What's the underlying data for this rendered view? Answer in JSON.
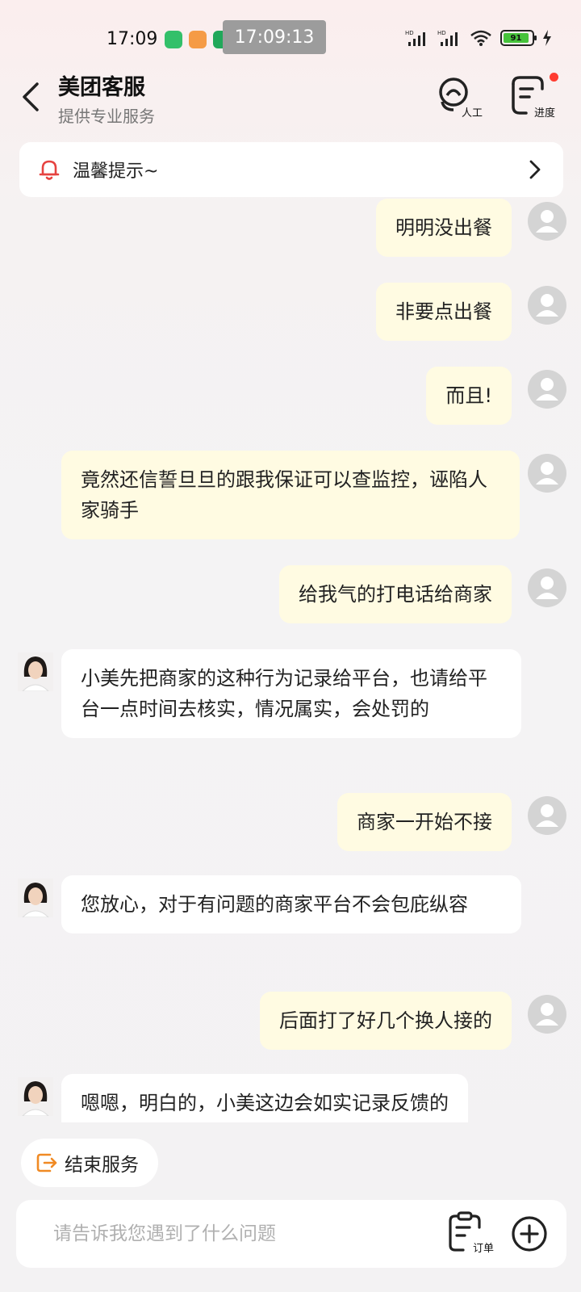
{
  "status_bar": {
    "time": "17:09",
    "overlay_time": "17:09:13",
    "battery": "91",
    "app_icons": [
      "green-app-icon",
      "meituan-app-icon",
      "green-app-icon-2"
    ]
  },
  "header": {
    "title": "美团客服",
    "subtitle": "提供专业服务",
    "human_label": "人工",
    "progress_label": "进度"
  },
  "tip": {
    "text": "温馨提示~"
  },
  "messages": [
    {
      "from": "user",
      "text": "明明没出餐"
    },
    {
      "from": "user",
      "text": "非要点出餐"
    },
    {
      "from": "user",
      "text": "而且!"
    },
    {
      "from": "user",
      "text": "竟然还信誓旦旦的跟我保证可以查监控，诬陷人家骑手"
    },
    {
      "from": "user",
      "text": "给我气的打电话给商家"
    },
    {
      "from": "agent",
      "text": "小美先把商家的这种行为记录给平台，也请给平台一点时间去核实，情况属实，会处罚的"
    },
    {
      "from": "user",
      "text": "商家一开始不接"
    },
    {
      "from": "agent",
      "text": "您放心，对于有问题的商家平台不会包庇纵容"
    },
    {
      "from": "user",
      "text": "后面打了好几个换人接的"
    },
    {
      "from": "agent",
      "text": "嗯嗯，明白的，小美这边会如实记录反馈的"
    }
  ],
  "end_service": {
    "label": "结束服务"
  },
  "input": {
    "placeholder": "请告诉我您遇到了什么问题",
    "value": ""
  },
  "order": {
    "label": "订单"
  },
  "colors": {
    "user_bubble": "#fffbe2",
    "agent_bubble": "#ffffff",
    "accent_orange": "#f08a24",
    "alert_red": "#e64340"
  }
}
